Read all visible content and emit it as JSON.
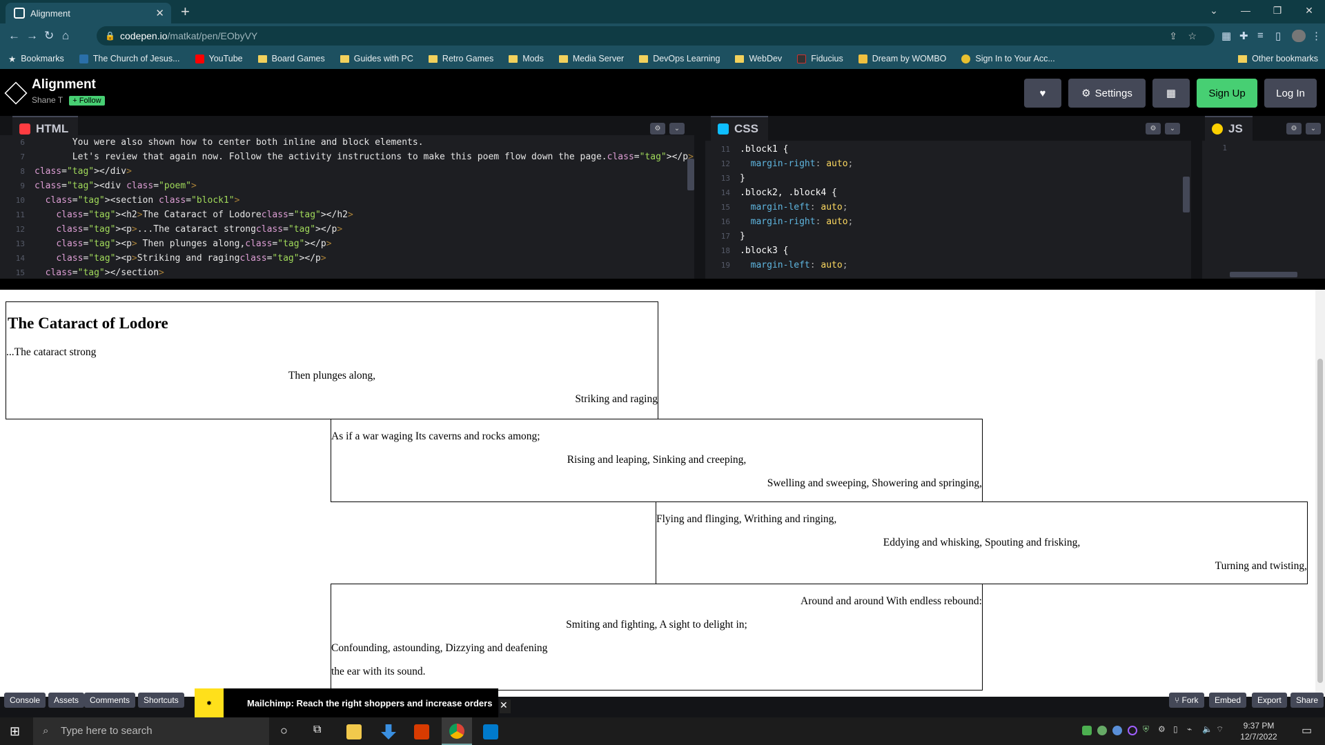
{
  "browser": {
    "tab_title": "Alignment",
    "url_host": "codepen.io",
    "url_path": "/matkat/pen/EObyVY",
    "bookmarks": [
      {
        "label": "Bookmarks",
        "icon": "star-icon"
      },
      {
        "label": "The Church of Jesus...",
        "icon": "church-icon"
      },
      {
        "label": "YouTube",
        "icon": "youtube-icon"
      },
      {
        "label": "Board Games",
        "icon": "folder-icon"
      },
      {
        "label": "Guides with PC",
        "icon": "folder-icon"
      },
      {
        "label": "Retro Games",
        "icon": "folder-icon"
      },
      {
        "label": "Mods",
        "icon": "folder-icon"
      },
      {
        "label": "Media Server",
        "icon": "folder-icon"
      },
      {
        "label": "DevOps Learning",
        "icon": "folder-icon"
      },
      {
        "label": "WebDev",
        "icon": "folder-icon"
      },
      {
        "label": "Fiducius",
        "icon": "fiducius-icon"
      },
      {
        "label": "Dream by WOMBO",
        "icon": "wombo-icon"
      },
      {
        "label": "Sign In to Your Acc...",
        "icon": "bitwarden-icon"
      }
    ],
    "other_bookmarks": "Other bookmarks"
  },
  "codepen": {
    "title": "Alignment",
    "author": "Shane T",
    "follow_label": "+ Follow",
    "settings_label": "Settings",
    "signup_label": "Sign Up",
    "login_label": "Log In",
    "panes": {
      "html": "HTML",
      "css": "CSS",
      "js": "JS"
    }
  },
  "html_code": [
    {
      "n": "6",
      "text": "       You were also shown how to center both inline and block elements."
    },
    {
      "n": "7",
      "text": "       Let's review that again now. Follow the activity instructions to make this poem flow down the page.</p>"
    },
    {
      "n": "8",
      "text": "</div>"
    },
    {
      "n": "9",
      "text": "<div class=\"poem\">"
    },
    {
      "n": "10",
      "text": "  <section class=\"block1\">"
    },
    {
      "n": "11",
      "text": "    <h2>The Cataract of Lodore</h2>"
    },
    {
      "n": "12",
      "text": "    <p>...The cataract strong</p>"
    },
    {
      "n": "13",
      "text": "    <p> Then plunges along,</p>"
    },
    {
      "n": "14",
      "text": "    <p>Striking and raging</p>"
    },
    {
      "n": "15",
      "text": "  </section>"
    }
  ],
  "css_code": [
    {
      "n": "11",
      "text": ".block1 {"
    },
    {
      "n": "12",
      "text": "  margin-right: auto;"
    },
    {
      "n": "13",
      "text": "}"
    },
    {
      "n": "14",
      "text": ".block2, .block4 {"
    },
    {
      "n": "15",
      "text": "  margin-left: auto;"
    },
    {
      "n": "16",
      "text": "  margin-right: auto;"
    },
    {
      "n": "17",
      "text": "}"
    },
    {
      "n": "18",
      "text": ".block3 {"
    },
    {
      "n": "19",
      "text": "  margin-left: auto;"
    }
  ],
  "js_code": [
    {
      "n": "1",
      "text": ""
    }
  ],
  "preview": {
    "block1": {
      "heading": "The Cataract of Lodore",
      "lines": [
        "...The cataract strong",
        "Then plunges along,",
        "Striking and raging"
      ]
    },
    "block2": {
      "lines": [
        "As if a war waging Its caverns and rocks among;",
        "Rising and leaping, Sinking and creeping,",
        "Swelling and sweeping, Showering and springing,"
      ]
    },
    "block3": {
      "lines": [
        "Flying and flinging, Writhing and ringing,",
        "Eddying and whisking, Spouting and frisking,",
        "Turning and twisting,"
      ]
    },
    "block4": {
      "lines": [
        "Around and around With endless rebound:",
        "Smiting and fighting, A sight to delight in;",
        "Confounding, astounding, Dizzying and deafening",
        "the ear with its sound."
      ]
    }
  },
  "footer": {
    "console": "Console",
    "assets": "Assets",
    "comments": "Comments",
    "shortcuts": "Shortcuts",
    "ad_text": "Mailchimp: Reach the right shoppers and increase orders",
    "fork": "Fork",
    "embed": "Embed",
    "export": "Export",
    "share": "Share"
  },
  "taskbar": {
    "search_placeholder": "Type here to search",
    "time": "9:37 PM",
    "date": "12/7/2022"
  }
}
